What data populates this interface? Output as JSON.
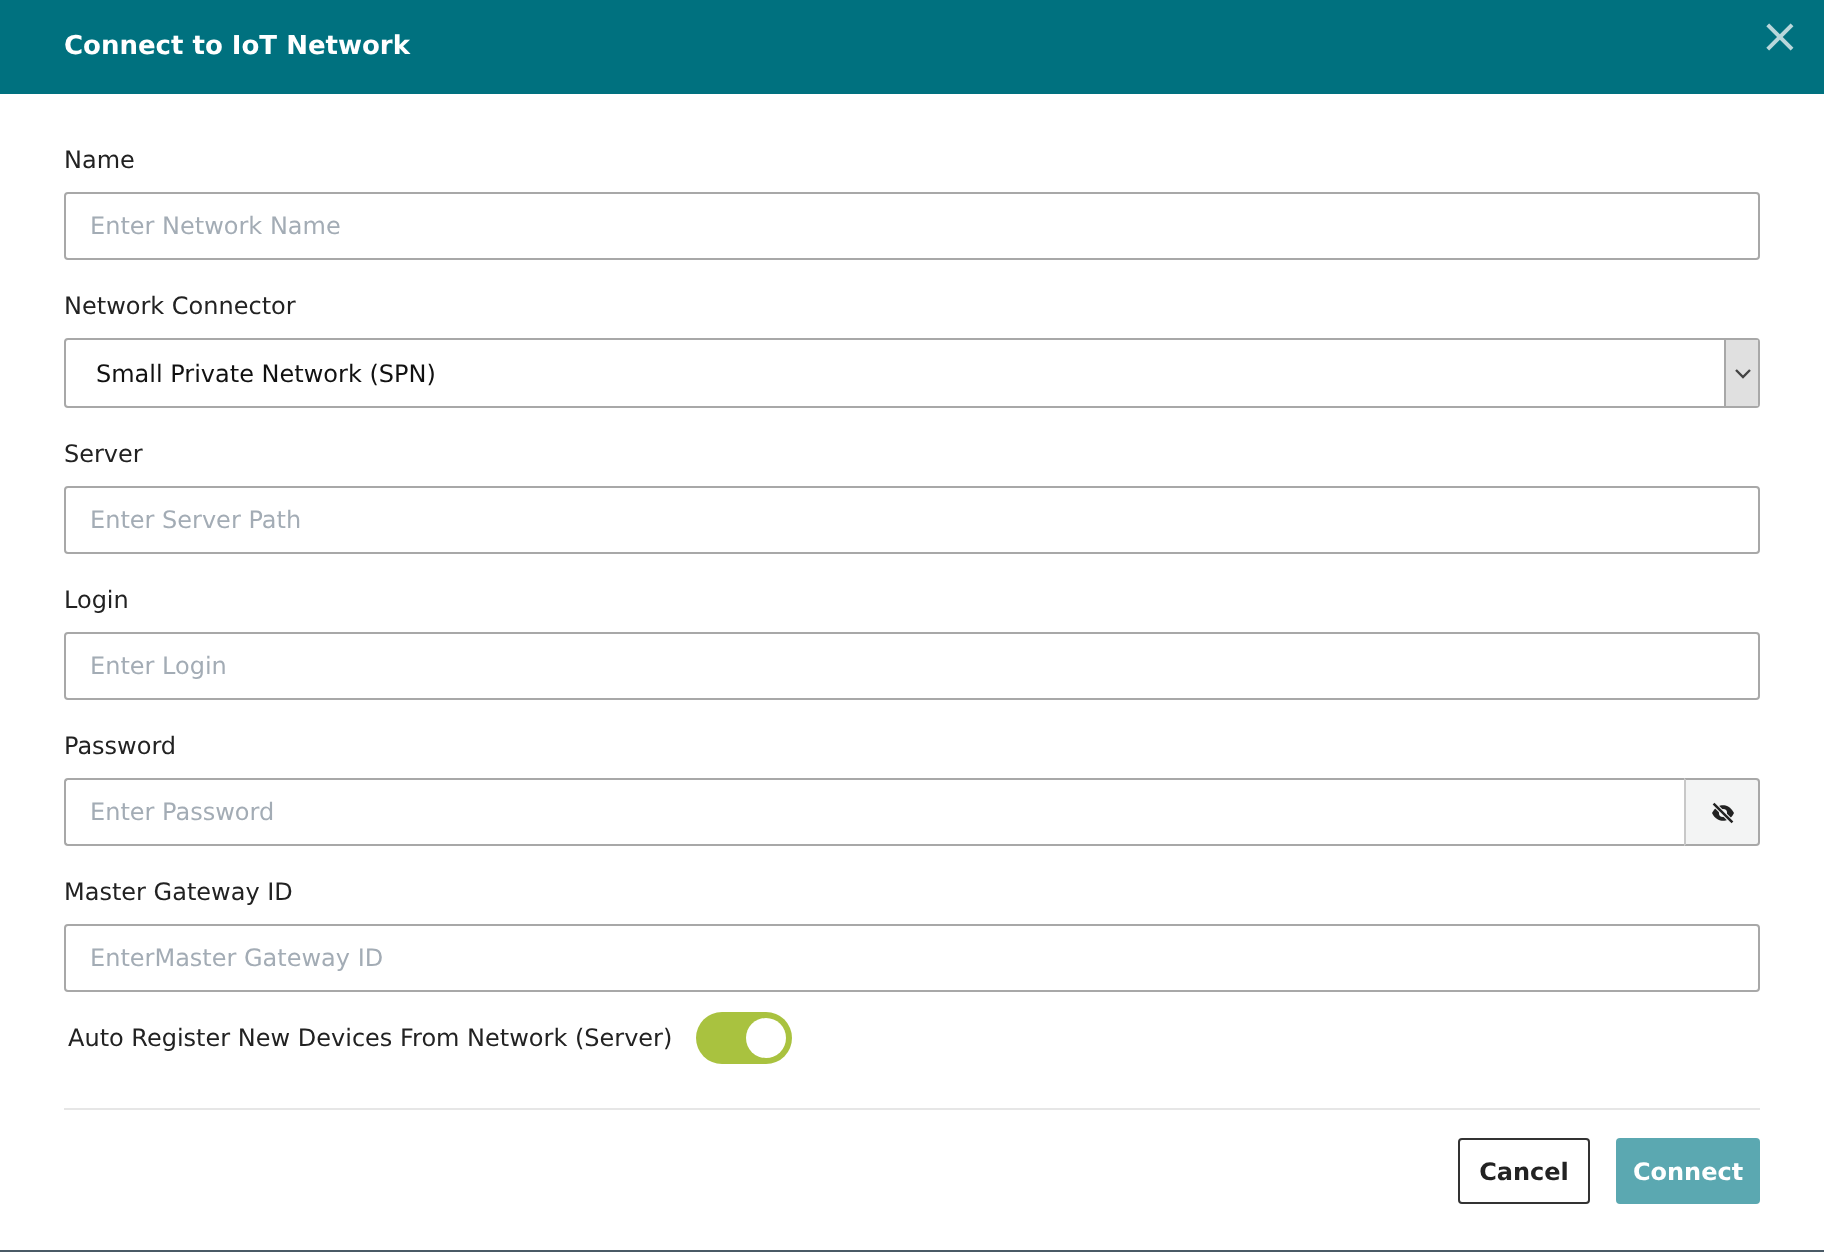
{
  "dialog": {
    "title": "Connect to IoT Network",
    "close": "×"
  },
  "fields": [
    {
      "kind": "text",
      "label": "Name",
      "placeholder": "Enter Network Name"
    },
    {
      "kind": "select",
      "label": "Network Connector",
      "value": "Small Private Network (SPN)"
    },
    {
      "kind": "text",
      "label": "Server",
      "placeholder": "Enter Server Path"
    },
    {
      "kind": "text",
      "label": "Login",
      "placeholder": "Enter Login"
    },
    {
      "kind": "password",
      "label": "Password",
      "placeholder": "Enter Password"
    },
    {
      "kind": "text",
      "label": "Master Gateway ID",
      "placeholder": "EnterMaster Gateway ID"
    }
  ],
  "toggle": {
    "label": "Auto Register New Devices From Network (Server)",
    "on": true
  },
  "buttons": [
    {
      "kind": "secondary",
      "label": "Cancel",
      "disabled": false
    },
    {
      "kind": "primary",
      "label": "Connect",
      "disabled": true
    }
  ]
}
